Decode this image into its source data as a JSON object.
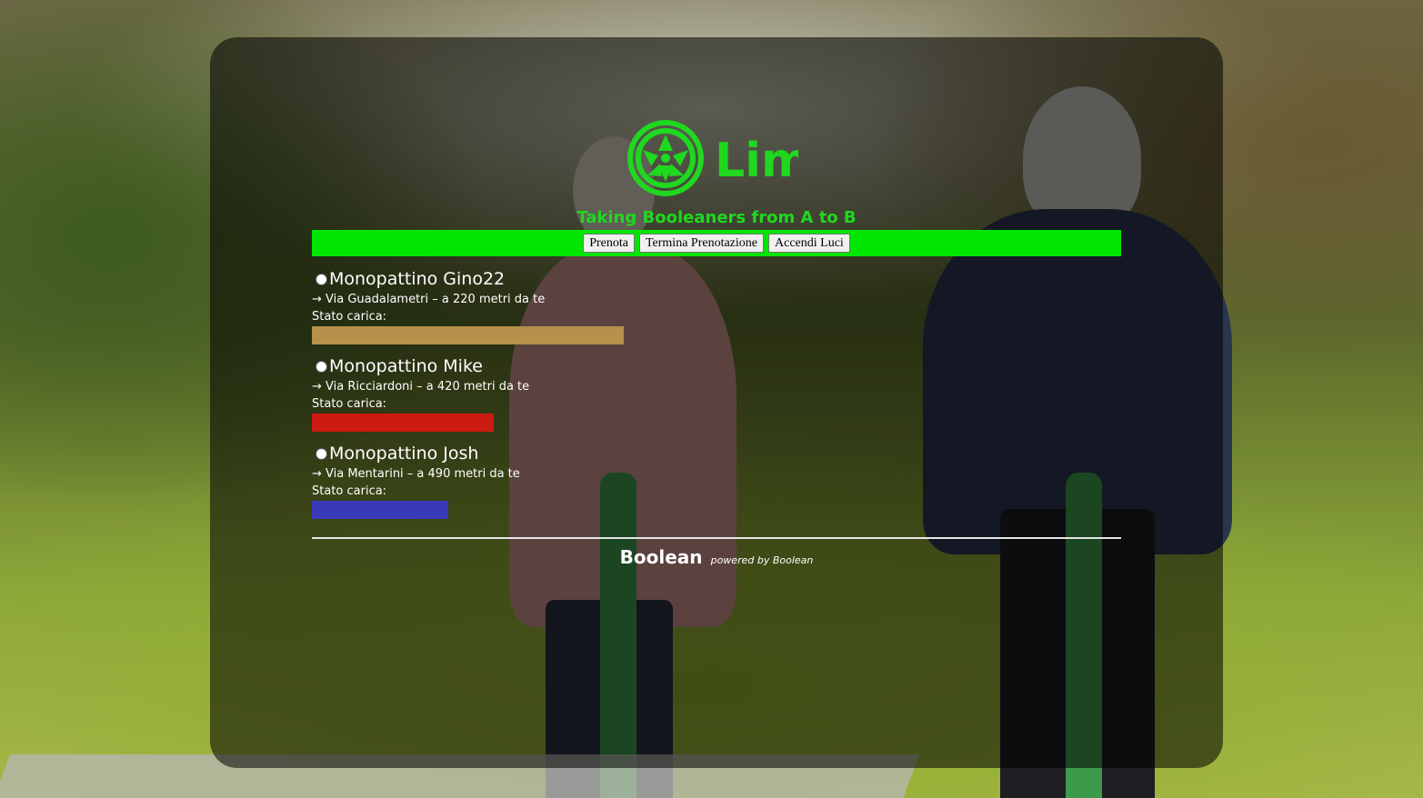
{
  "header": {
    "logo_text": "Lim",
    "tagline": "Taking Booleaners from A to B",
    "accent_color": "#1fd81f"
  },
  "toolbar": {
    "background": "#00e600",
    "prenota_label": "Prenota",
    "termina_label": "Termina Prenotazione",
    "luci_label": "Accendi Luci"
  },
  "scooters": [
    {
      "name": "Monopattino Gino22",
      "address": "→ Via Guadalametri – a 220 metri da te",
      "charge_label": "Stato carica:",
      "charge_color": "#b5914b",
      "charge_level": 0.385
    },
    {
      "name": "Monopattino Mike",
      "address": "→ Via Ricciardoni – a 420 metri da te",
      "charge_label": "Stato carica:",
      "charge_color": "#cc1a0e",
      "charge_level": 0.225
    },
    {
      "name": "Monopattino Josh",
      "address": "→ Via Mentarini – a 490 metri da te",
      "charge_label": "Stato carica:",
      "charge_color": "#3a3ab8",
      "charge_level": 0.169
    }
  ],
  "footer": {
    "brand": "Boolean",
    "powered": "powered by Boolean"
  }
}
